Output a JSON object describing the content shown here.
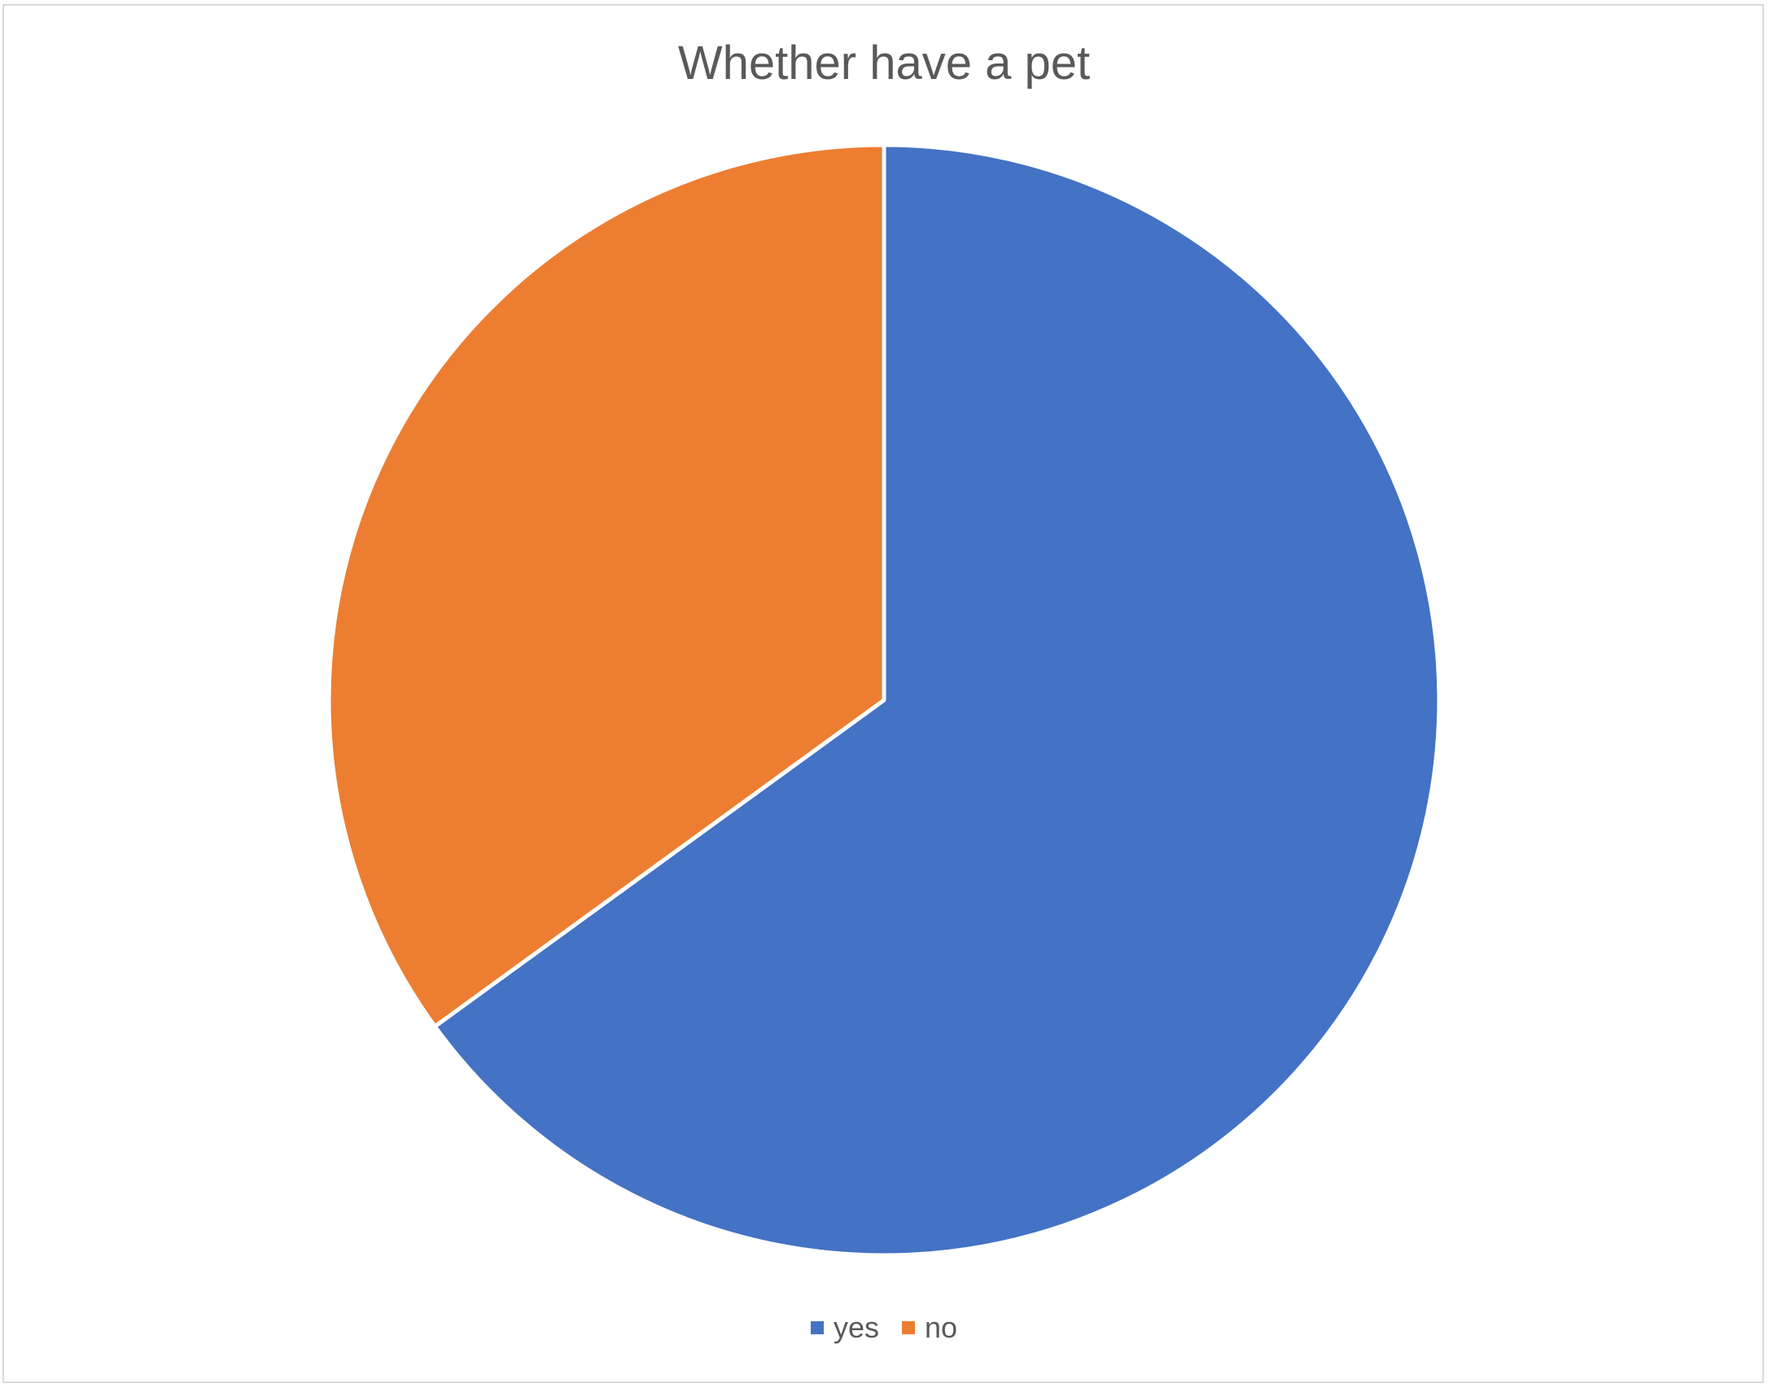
{
  "chart_data": {
    "type": "pie",
    "title": "Whether have a pet",
    "categories": [
      "yes",
      "no"
    ],
    "values": [
      65,
      35
    ],
    "colors": [
      "#4472C4",
      "#ED7D31"
    ],
    "start_angle": "12 o'clock",
    "direction": "clockwise",
    "legend_position": "bottom"
  }
}
